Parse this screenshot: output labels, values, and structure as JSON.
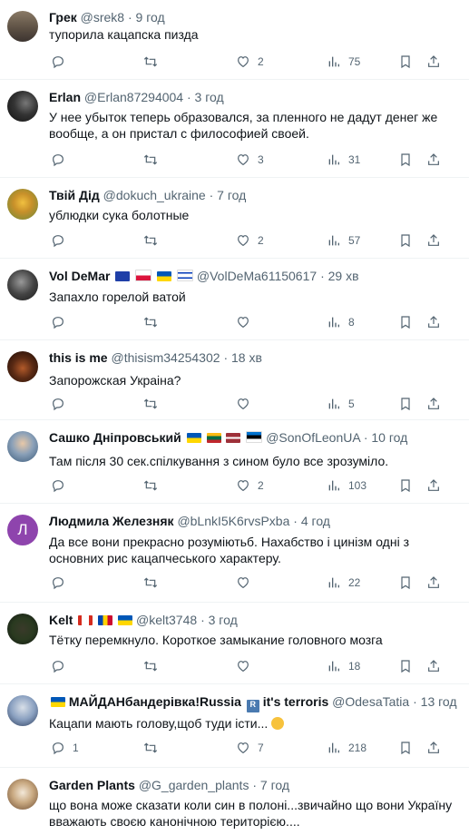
{
  "tweets": [
    {
      "name": "Грек",
      "handle": "@srek8",
      "time": "9 год",
      "text": "тупорила кацапска пизда",
      "replies": "",
      "retweets": "",
      "likes": "2",
      "views": "75"
    },
    {
      "name": "Erlan",
      "handle": "@Erlan87294004",
      "time": "3 год",
      "text": "У нее убыток теперь образовался, за пленного не дадут денег же вообще, а он пристал с  философией своей.",
      "replies": "",
      "retweets": "",
      "likes": "3",
      "views": "31"
    },
    {
      "name": "Твій Дід",
      "handle": "@dokuch_ukraine",
      "time": "7 год",
      "text": "ублюдки сука болотные",
      "replies": "",
      "retweets": "",
      "likes": "2",
      "views": "57"
    },
    {
      "name": "Vol DeMar",
      "handle": "@VolDeMa61150617",
      "time": "29 хв",
      "text": "Запахло горелой ватой",
      "replies": "",
      "retweets": "",
      "likes": "",
      "views": "8"
    },
    {
      "name": "this is me",
      "handle": "@thisism34254302",
      "time": "18 хв",
      "text": "Запорожская Украіна?",
      "replies": "",
      "retweets": "",
      "likes": "",
      "views": "5"
    },
    {
      "name": "Сашко Дніпровський",
      "handle": "@SonOfLeonUA",
      "time": "10 год",
      "text": "Там після 30 сек.спілкування з сином було все зрозуміло.",
      "replies": "",
      "retweets": "",
      "likes": "2",
      "views": "103"
    },
    {
      "name": "Людмила Железняк",
      "handle": "@bLnkI5K6rvsPxba",
      "time": "4 год",
      "text": "Да все вони прекрасно розуміютьб. Нахабство  і цинізм одні з основних рис кацапчеського характеру.",
      "replies": "",
      "retweets": "",
      "likes": "",
      "views": "22"
    },
    {
      "name": "Kelt",
      "handle": "@kelt3748",
      "time": "3 год",
      "text": "Тётку перемкнуло. Короткое замыкание головного мозга",
      "replies": "",
      "retweets": "",
      "likes": "",
      "views": "18"
    },
    {
      "name": "МАЙДАНбандерівка!Russia",
      "name_suffix": "it's terroris",
      "handle": "@OdesaTatia",
      "time": "13 год",
      "text": "Кацапи мають голову,щоб туди істи...",
      "replies": "1",
      "retweets": "",
      "likes": "7",
      "views": "218"
    },
    {
      "name": "Garden Plants",
      "handle": "@G_garden_plants",
      "time": "7 год",
      "text": "що вона може сказати коли син  в полоні...звичайно що вони Україну вважають своєю канонічною територією....",
      "replies": "",
      "retweets": "",
      "likes": "",
      "views": ""
    }
  ],
  "avatar_letter_7": "Л",
  "colors": {
    "text": "#0f1419",
    "muted": "#536471",
    "divider": "#eff3f4",
    "avatar_purple": "#8e44ad"
  }
}
